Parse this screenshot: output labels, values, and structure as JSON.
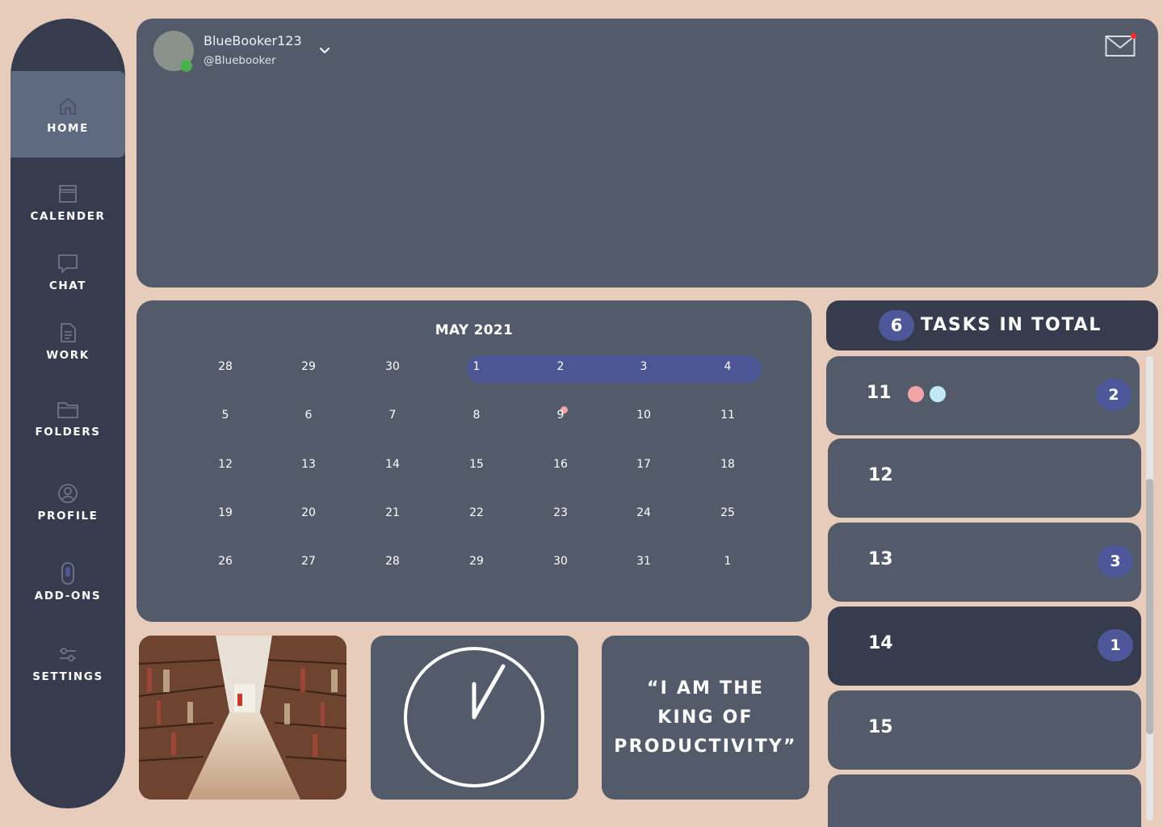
{
  "sidebar": {
    "items": [
      {
        "label": "HOME",
        "icon": "home-icon"
      },
      {
        "label": "CALENDER",
        "icon": "calendar-icon"
      },
      {
        "label": "CHAT",
        "icon": "chat-icon"
      },
      {
        "label": "WORK",
        "icon": "document-icon"
      },
      {
        "label": "FOLDERS",
        "icon": "folder-icon"
      },
      {
        "label": "PROFILE",
        "icon": "user-icon"
      },
      {
        "label": "ADD-ONS",
        "icon": "toggle-icon"
      },
      {
        "label": "SETTINGS",
        "icon": "sliders-icon"
      }
    ],
    "active": "HOME"
  },
  "header": {
    "username": "BlueBooker123",
    "handle": "@Bluebooker",
    "status": "online",
    "has_unread_mail": true
  },
  "calendar": {
    "title": "MAY 2021",
    "weeks": [
      [
        "28",
        "29",
        "30",
        "1",
        "2",
        "3",
        "4"
      ],
      [
        "5",
        "6",
        "7",
        "8",
        "9",
        "10",
        "11"
      ],
      [
        "12",
        "13",
        "14",
        "15",
        "16",
        "17",
        "18"
      ],
      [
        "19",
        "20",
        "21",
        "22",
        "23",
        "24",
        "25"
      ],
      [
        "26",
        "27",
        "28",
        "29",
        "30",
        "31",
        "1"
      ]
    ],
    "highlighted_range": [
      "1",
      "4"
    ],
    "marked_day": "9"
  },
  "quote": {
    "lines": [
      "“I AM THE",
      "KING OF",
      "PRODUCTIVITY”"
    ]
  },
  "tasks": {
    "total": "6",
    "title": "TASKS IN TOTAL",
    "days": [
      {
        "day": "11",
        "count": "2",
        "tags": [
          "#f3a4a8",
          "#bfe9f7"
        ]
      },
      {
        "day": "12",
        "count": "",
        "tags": []
      },
      {
        "day": "13",
        "count": "3",
        "tags": []
      },
      {
        "day": "14",
        "count": "1",
        "tags": [],
        "selected": true
      },
      {
        "day": "15",
        "count": "",
        "tags": []
      },
      {
        "day": "",
        "count": "",
        "tags": []
      }
    ]
  },
  "colors": {
    "background": "#e8ccbb",
    "panel": "#535a69",
    "sidebar": "#363c4d",
    "accent": "#4f579b",
    "online": "#4caf50",
    "notification": "#ff2a2a"
  }
}
